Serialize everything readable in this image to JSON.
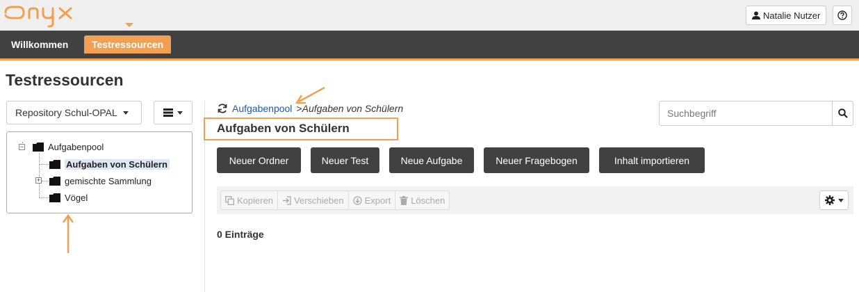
{
  "header": {
    "logo_text": "Onyx",
    "user_label": "Natalie Nutzer"
  },
  "nav": {
    "home": "Willkommen",
    "active": "Testressourcen"
  },
  "page": {
    "title": "Testressourcen"
  },
  "sidebar": {
    "repository_select": "Repository Schul-OPAL",
    "tree": [
      {
        "label": "Aufgabenpool"
      },
      {
        "label": "Aufgaben von Schülern"
      },
      {
        "label": "gemischte Sammlung"
      },
      {
        "label": "Vögel"
      }
    ]
  },
  "main": {
    "breadcrumb": {
      "link": "Aufgabenpool",
      "separator": ">",
      "current": "Aufgaben von Schülern"
    },
    "heading": "Aufgaben von Schülern",
    "search": {
      "placeholder": "Suchbegriff"
    },
    "actions": [
      "Neuer Ordner",
      "Neuer Test",
      "Neue Aufgabe",
      "Neuer Fragebogen",
      "Inhalt importieren"
    ],
    "toolbar": [
      "Kopieren",
      "Verschieben",
      "Export",
      "Löschen"
    ],
    "entries": "0 Einträge"
  },
  "colors": {
    "accent": "#f0a050",
    "nav_bg": "#414141",
    "link": "#1c5aa6"
  },
  "icons": [
    "user-icon",
    "help-icon",
    "caret-down-icon",
    "list-menu-icon",
    "folder-icon",
    "refresh-icon",
    "search-icon",
    "copy-icon",
    "move-icon",
    "export-icon",
    "trash-icon",
    "gear-icon"
  ]
}
